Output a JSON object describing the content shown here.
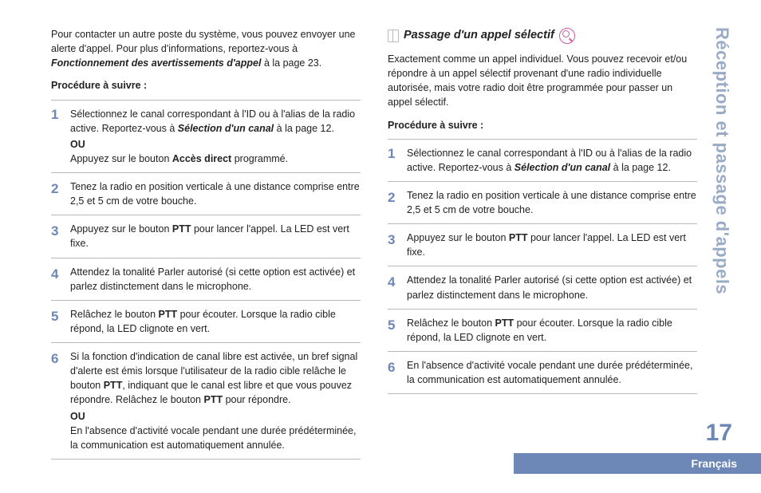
{
  "chapter_title": "Réception et passage d'appels",
  "page_number": "17",
  "language_label": "Français",
  "left": {
    "intro_parts": [
      "Pour contacter un autre poste du système, vous pouvez envoyer une alerte d'appel. Pour plus d'informations, reportez-vous à ",
      "Fonctionnement des avertissements d'appel",
      " à la page 23."
    ],
    "procedure_header": "Procédure à suivre :",
    "steps": [
      {
        "parts": [
          "Sélectionnez le canal correspondant à l'ID ou à l'alias de la radio active. Reportez-vous à ",
          "Sélection d'un canal",
          " à la page 12."
        ],
        "or_label": "OU",
        "after_or_parts": [
          "Appuyez sur le bouton ",
          "Accès direct",
          " programmé."
        ]
      },
      {
        "parts": [
          "Tenez la radio en position verticale à une distance comprise entre 2,5 et 5 cm de votre bouche."
        ]
      },
      {
        "parts": [
          "Appuyez sur le bouton ",
          "PTT",
          " pour lancer l'appel. La LED est vert fixe."
        ]
      },
      {
        "parts": [
          "Attendez la tonalité Parler autorisé (si cette option est activée) et parlez distinctement dans le microphone."
        ]
      },
      {
        "parts": [
          "Relâchez le bouton ",
          "PTT",
          " pour écouter. Lorsque la radio cible répond, la LED clignote en vert."
        ]
      },
      {
        "parts": [
          "Si la fonction d'indication de canal libre est activée, un bref signal d'alerte est émis lorsque l'utilisateur de la radio cible relâche le bouton ",
          "PTT",
          ", indiquant que le canal est libre et que vous pouvez répondre. Relâchez le bouton ",
          "PTT",
          " pour répondre."
        ],
        "or_label": "OU",
        "after_or_parts": [
          "En l'absence d'activité vocale pendant une durée prédéterminée, la communication est automatiquement annulée."
        ]
      }
    ]
  },
  "right": {
    "section_title": "Passage d'un appel sélectif",
    "intro": "Exactement comme un appel individuel. Vous pouvez recevoir et/ou répondre à un appel sélectif provenant d'une radio individuelle autorisée, mais votre radio doit être programmée pour passer un appel sélectif.",
    "procedure_header": "Procédure à suivre :",
    "steps": [
      {
        "parts": [
          "Sélectionnez le canal correspondant à l'ID ou à l'alias de la radio active. Reportez-vous à ",
          "Sélection d'un canal",
          " à la page 12."
        ]
      },
      {
        "parts": [
          "Tenez la radio en position verticale à une distance comprise entre 2,5 et 5 cm de votre bouche."
        ]
      },
      {
        "parts": [
          "Appuyez sur le bouton ",
          "PTT",
          " pour lancer l'appel. La LED est vert fixe."
        ]
      },
      {
        "parts": [
          "Attendez la tonalité Parler autorisé (si cette option est activée) et parlez distinctement dans le microphone."
        ]
      },
      {
        "parts": [
          "Relâchez le bouton ",
          "PTT",
          " pour écouter. Lorsque la radio cible répond, la LED clignote en vert."
        ]
      },
      {
        "parts": [
          "En l'absence d'activité vocale pendant une durée prédéterminée, la communication est automatiquement annulée."
        ]
      }
    ]
  }
}
